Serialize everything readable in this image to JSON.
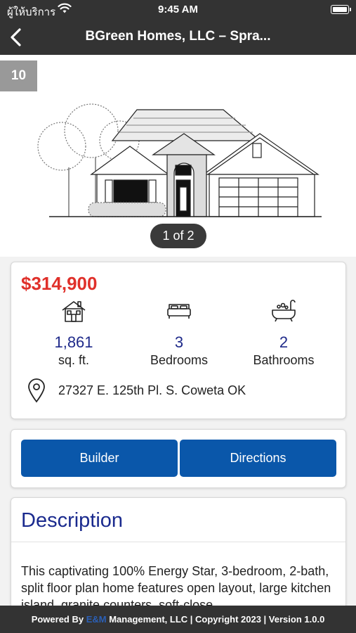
{
  "status_bar": {
    "carrier": "ผู้ให้บริการ",
    "time": "9:45 AM"
  },
  "nav": {
    "title": "BGreen Homes, LLC  – Spra..."
  },
  "hero": {
    "badge": "10",
    "pager": "1 of 2"
  },
  "listing": {
    "price": "$314,900",
    "sqft_value": "1,861",
    "sqft_label": "sq. ft.",
    "bedrooms_value": "3",
    "bedrooms_label": "Bedrooms",
    "bathrooms_value": "2",
    "bathrooms_label": "Bathrooms",
    "address": "27327 E. 125th Pl. S. Coweta OK"
  },
  "actions": {
    "builder_label": "Builder",
    "directions_label": "Directions"
  },
  "description": {
    "title": "Description",
    "text": "This captivating 100% Energy Star, 3-bedroom, 2-bath, split floor plan home features open layout, large kitchen island, granite counters, soft-close"
  },
  "footer": {
    "prefix": "Powered By ",
    "brand": "E&M",
    "suffix": " Management, LLC | Copyright 2023 | Version 1.0.0"
  },
  "colors": {
    "price": "#e0302a",
    "accent_blue": "#0a57aa",
    "stat_number": "#1f2a8a",
    "bars": "#333333"
  },
  "icons": [
    "wifi-icon",
    "battery-icon",
    "back-chevron-icon",
    "house-icon",
    "bed-icon",
    "bathtub-icon",
    "location-pin-icon"
  ]
}
